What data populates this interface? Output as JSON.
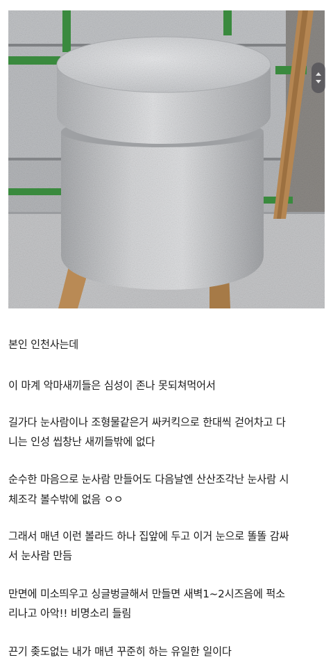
{
  "image": {
    "subject": "granite-bollard-photo"
  },
  "scroll_control": {
    "icon": "scroll-arrows-icon"
  },
  "post": {
    "lines": [
      "본인 인천사는데",
      "이 마계 악마새끼들은 심성이 존나 못되쳐먹어서",
      "길가다 눈사람이나 조형물같은거 싸커킥으로 한대씩 걷어차고 다",
      "니는 인성 씹창난 새끼들밖에 없다",
      "순수한 마음으로 눈사람 만들어도 다음날엔 산산조각난 눈사람 시",
      "체조각 볼수밖에 없음 ㅇㅇ",
      "그래서 매년 이런 볼라드 하나 집앞에 두고 이거 눈으로 똘똘 감싸",
      "서 눈사람 만듬",
      "만면에 미소띄우고 싱글벙글해서 만들면 새벽1~2시즈음에 퍽소",
      "리나고 아악!! 비명소리 들림",
      "끈기 좆도없는 내가 매년 꾸준히 하는 유일한 일이다"
    ]
  }
}
